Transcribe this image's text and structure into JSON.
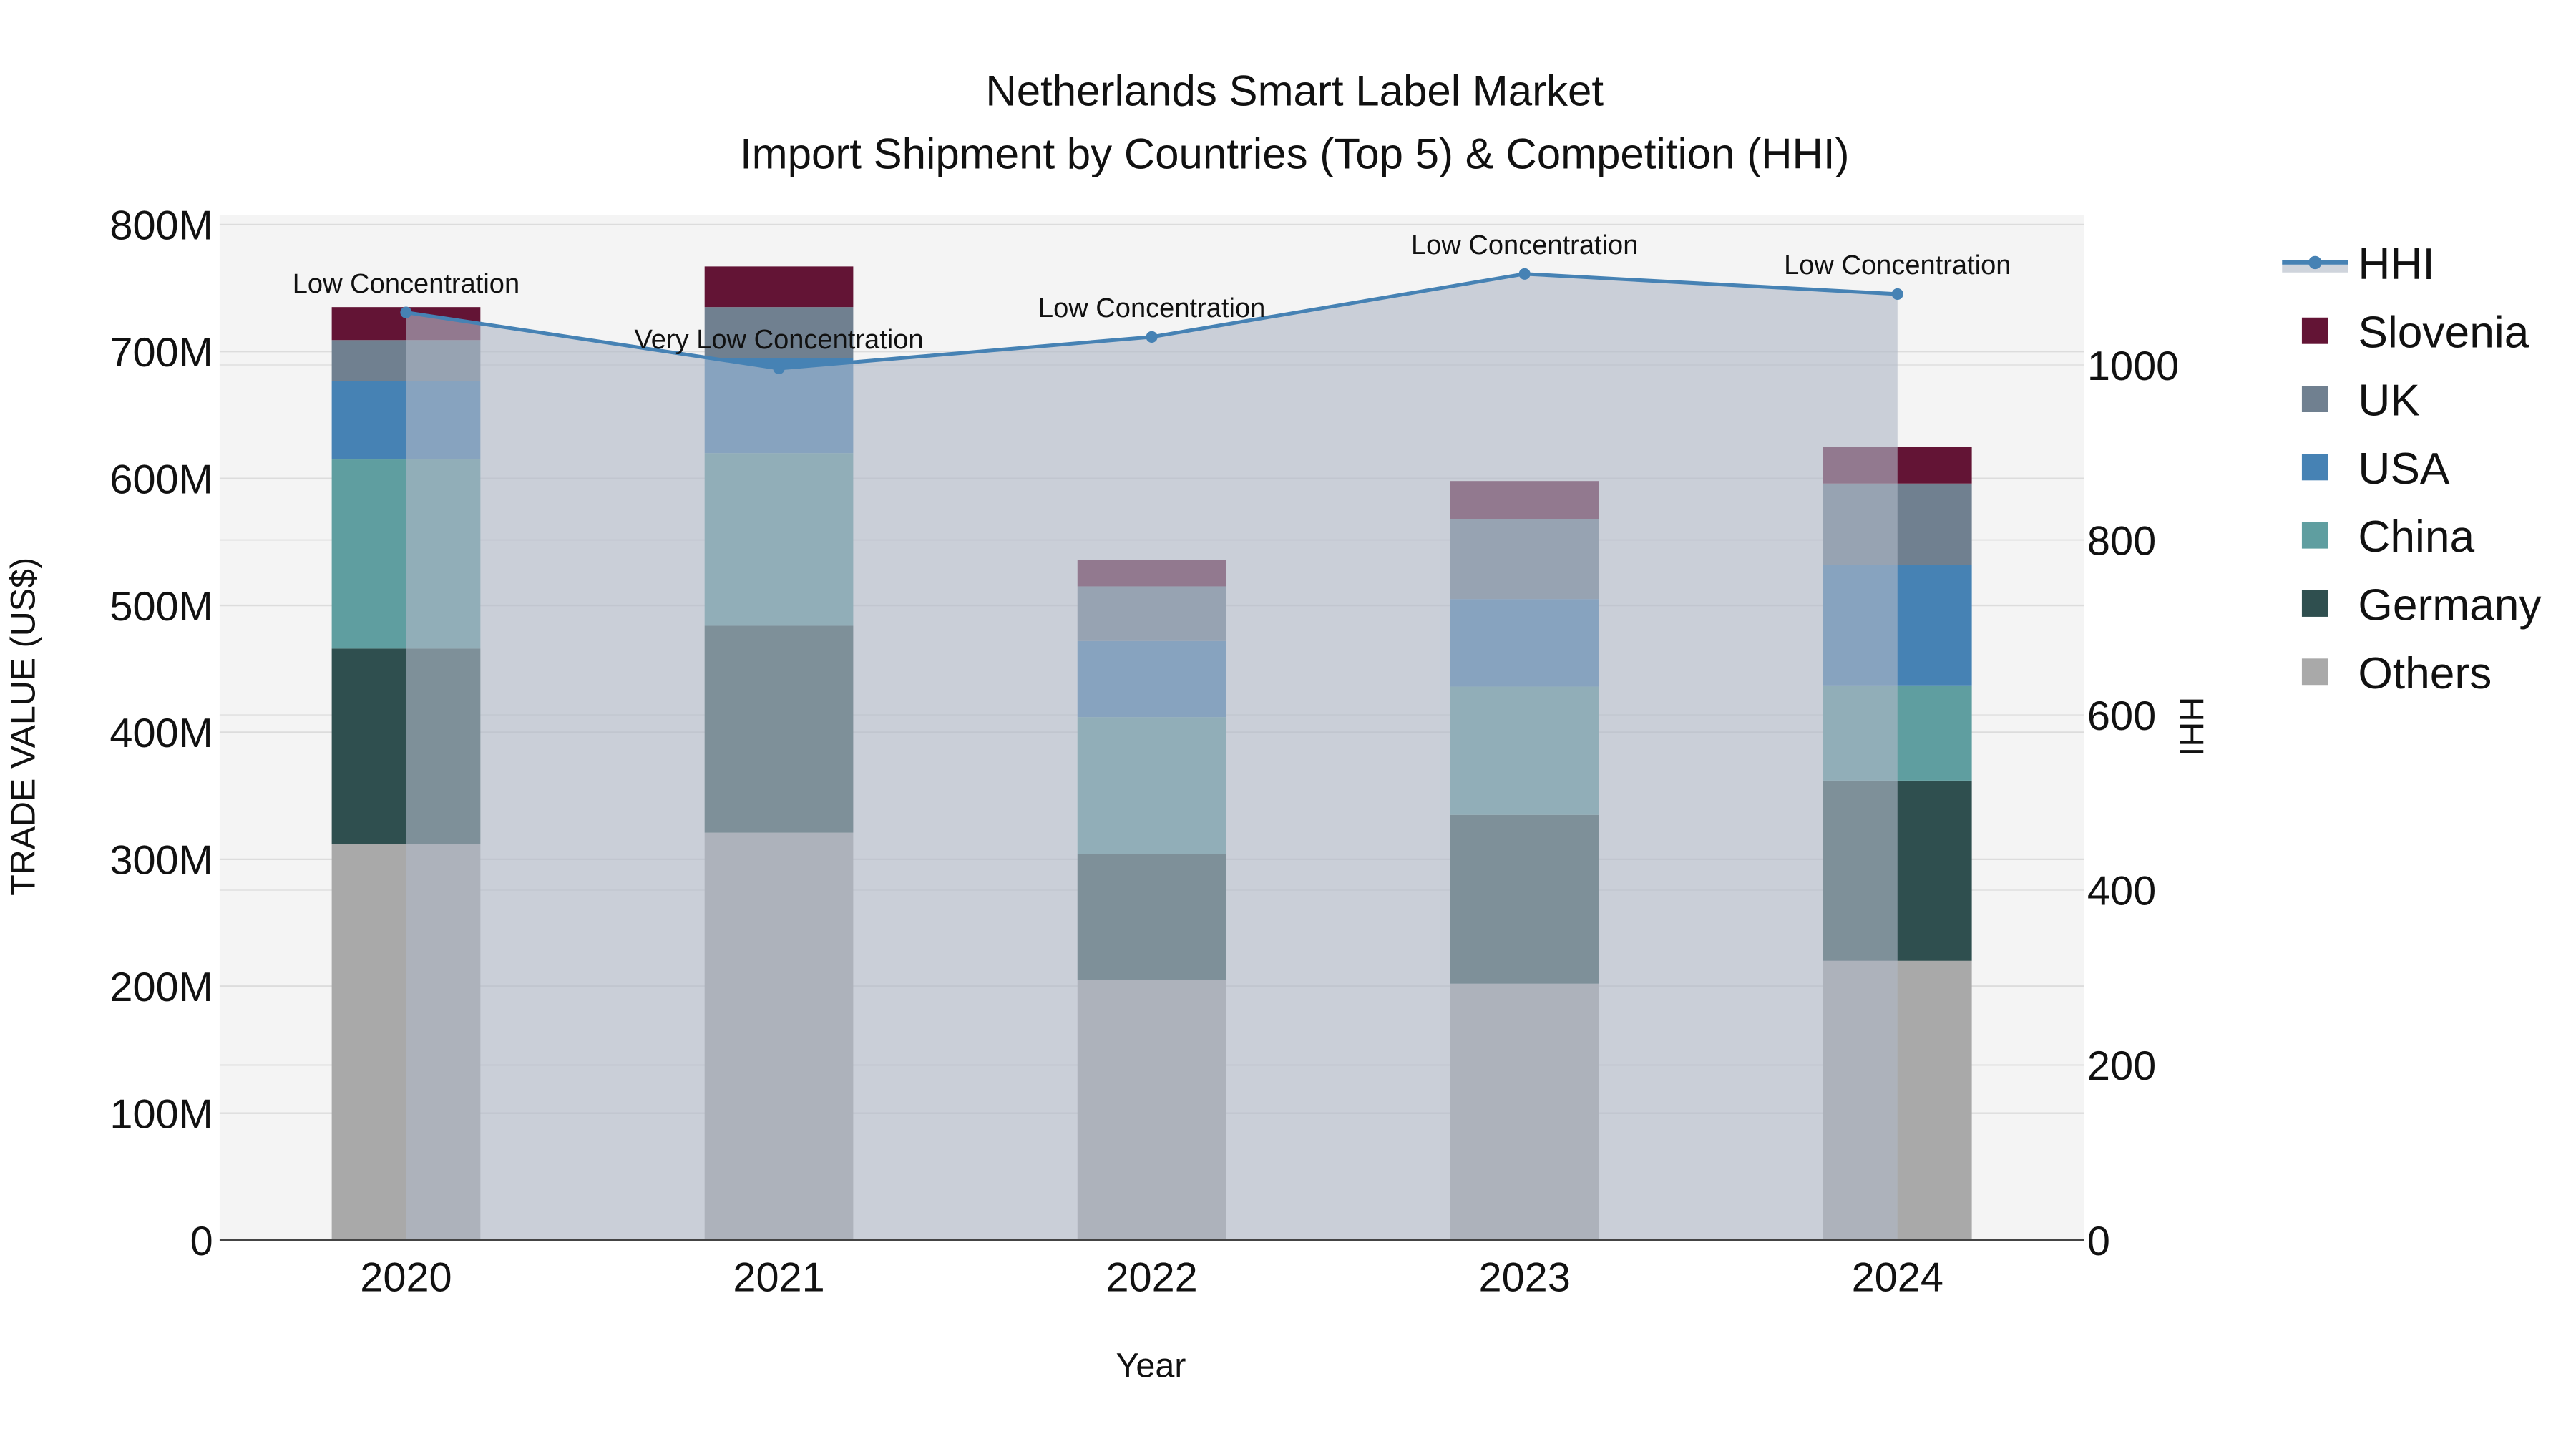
{
  "chart_data": {
    "type": "bar",
    "title": "Netherlands Smart Label Market",
    "subtitle": "Import Shipment by Countries (Top 5) & Competition (HHI)",
    "xlabel": "Year",
    "ylabel": "TRADE VALUE (US$)",
    "y2label": "HHI",
    "categories": [
      "2020",
      "2021",
      "2022",
      "2023",
      "2024"
    ],
    "ylim": [
      0,
      800000000
    ],
    "y2lim": [
      0,
      1170
    ],
    "yticks": [
      "0",
      "100M",
      "200M",
      "300M",
      "400M",
      "500M",
      "600M",
      "700M",
      "800M"
    ],
    "y2ticks": [
      "0",
      "200",
      "400",
      "600",
      "800",
      "1000"
    ],
    "stacked": true,
    "series": [
      {
        "name": "Others",
        "color": "#a9a9a9",
        "values": [
          312000000,
          321000000,
          205000000,
          202000000,
          220000000
        ]
      },
      {
        "name": "Germany",
        "color": "#2f4f4f",
        "values": [
          154000000,
          163000000,
          99000000,
          133000000,
          142000000
        ]
      },
      {
        "name": "China",
        "color": "#5f9ea0",
        "values": [
          149000000,
          136000000,
          108000000,
          101000000,
          75000000
        ]
      },
      {
        "name": "USA",
        "color": "#4682b4",
        "values": [
          62000000,
          75000000,
          60000000,
          69000000,
          95000000
        ]
      },
      {
        "name": "UK",
        "color": "#708090",
        "values": [
          32000000,
          40000000,
          43000000,
          63000000,
          64000000
        ]
      },
      {
        "name": "Slovenia",
        "color": "#631435",
        "values": [
          26000000,
          32000000,
          21000000,
          30000000,
          29000000
        ]
      }
    ],
    "hhi": {
      "name": "HHI",
      "color": "#4682b4",
      "values": [
        1060,
        996,
        1032,
        1104,
        1081
      ],
      "labels": [
        "Low Concentration",
        "Very Low Concentration",
        "Low Concentration",
        "Low Concentration",
        "Low Concentration"
      ]
    },
    "legend": {
      "position": "right",
      "order": [
        "HHI",
        "Slovenia",
        "UK",
        "USA",
        "China",
        "Germany",
        "Others"
      ]
    },
    "grid": true
  }
}
